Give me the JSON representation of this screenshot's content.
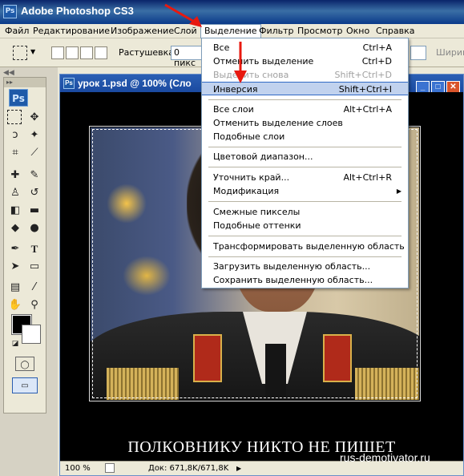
{
  "app": {
    "title": "Adobe Photoshop CS3",
    "logo": "Ps"
  },
  "menubar": {
    "items": [
      "Файл",
      "Редактирование",
      "Изображение",
      "Слой",
      "Выделение",
      "Фильтр",
      "Просмотр",
      "Окно",
      "Справка"
    ],
    "active": "Выделение"
  },
  "options": {
    "feather_label": "Растушевка:",
    "feather_value": "0 пикс",
    "width_label": "Ширин"
  },
  "toolbox": {
    "logo": "Ps"
  },
  "document": {
    "title": "урок 1.psd @ 100% (Сло",
    "caption": "ПОЛКОВНИКУ НИКТО НЕ ПИШЕТ",
    "watermark": "rus-demotivator.ru",
    "zoom": "100 %",
    "doc_info": "Док: 671,8K/671,8K"
  },
  "select_menu": {
    "items": [
      {
        "label": "Все",
        "shortcut": "Ctrl+A",
        "disabled": false
      },
      {
        "label": "Отменить выделение",
        "shortcut": "Ctrl+D",
        "disabled": false
      },
      {
        "label": "Выделить снова",
        "shortcut": "Shift+Ctrl+D",
        "disabled": true
      },
      {
        "label": "Инверсия",
        "shortcut": "Shift+Ctrl+I",
        "disabled": false,
        "highlighted": true
      },
      {
        "label": "Все слои",
        "shortcut": "Alt+Ctrl+A",
        "disabled": false
      },
      {
        "label": "Отменить выделение слоев",
        "shortcut": "",
        "disabled": false
      },
      {
        "label": "Подобные слои",
        "shortcut": "",
        "disabled": false
      },
      {
        "label": "Цветовой диапазон...",
        "shortcut": "",
        "disabled": false
      },
      {
        "label": "Уточнить край...",
        "shortcut": "Alt+Ctrl+R",
        "disabled": false
      },
      {
        "label": "Модификация",
        "shortcut": "",
        "disabled": false,
        "submenu": true
      },
      {
        "label": "Смежные пикселы",
        "shortcut": "",
        "disabled": false
      },
      {
        "label": "Подобные оттенки",
        "shortcut": "",
        "disabled": false
      },
      {
        "label": "Трансформировать выделенную область",
        "shortcut": "",
        "disabled": false
      },
      {
        "label": "Загрузить выделенную область...",
        "shortcut": "",
        "disabled": false
      },
      {
        "label": "Сохранить выделенную область...",
        "shortcut": "",
        "disabled": false
      }
    ]
  },
  "colors": {
    "highlight": "#c1d2ee",
    "annotation_arrow": "#e8190f",
    "title_blue": "#0a246a"
  }
}
